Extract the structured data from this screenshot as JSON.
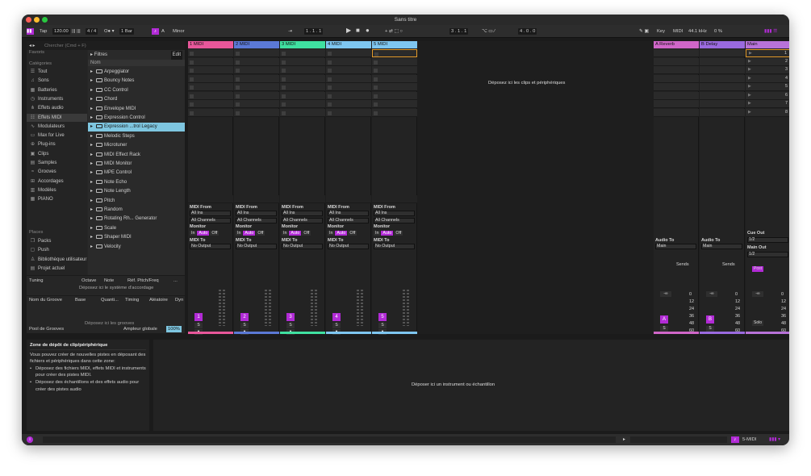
{
  "window": {
    "title": "Sans titre"
  },
  "transport": {
    "tap": "Tap",
    "bpm": "120.00",
    "time_sig": "4 / 4",
    "quant": "1 Bar",
    "key_root": "A",
    "key_scale": "Minor",
    "position": "1 . 1 . 1",
    "loop_start": "3 . 1 . 1",
    "loop_len": "4 . 0 . 0",
    "key_label": "Key",
    "midi_label": "MIDI",
    "sample_rate": "44.1 kHz",
    "cpu": "0 %"
  },
  "browser": {
    "search_placeholder": "Chercher (Cmd + F)",
    "favorites_title": "Favoris",
    "categories_title": "Catégories",
    "places_title": "Places",
    "categories": [
      {
        "label": "Tout",
        "icon": "☰"
      },
      {
        "label": "Sons",
        "icon": "♫"
      },
      {
        "label": "Batteries",
        "icon": "▦"
      },
      {
        "label": "Instruments",
        "icon": "◷"
      },
      {
        "label": "Effets audio",
        "icon": "⋔"
      },
      {
        "label": "Effets MIDI",
        "icon": "☷"
      },
      {
        "label": "Modulateurs",
        "icon": "∿"
      },
      {
        "label": "Max for Live",
        "icon": "▭"
      },
      {
        "label": "Plug-ins",
        "icon": "⊕"
      },
      {
        "label": "Clips",
        "icon": "▣"
      },
      {
        "label": "Samples",
        "icon": "▤"
      },
      {
        "label": "Grooves",
        "icon": "≈"
      },
      {
        "label": "Accordages",
        "icon": "⊞"
      },
      {
        "label": "Modèles",
        "icon": "▥"
      },
      {
        "label": "PIANO",
        "icon": "▦"
      }
    ],
    "places": [
      {
        "label": "Packs",
        "icon": "❐"
      },
      {
        "label": "Push",
        "icon": "▢"
      },
      {
        "label": "Bibliothèque utilisateur",
        "icon": "♙"
      },
      {
        "label": "Projet actuel",
        "icon": "▤"
      }
    ],
    "filters_label": "Filtres",
    "edit_label": "Edit",
    "column_name": "Nom",
    "files": [
      "Arpeggiator",
      "Bouncy Notes",
      "CC Control",
      "Chord",
      "Envelope MIDI",
      "Expression Control",
      "Expression ...trol Legacy",
      "Melodic Steps",
      "Microtuner",
      "MIDI Effect Rack",
      "MIDI Monitor",
      "MPE Control",
      "Note Echo",
      "Note Length",
      "Pitch",
      "Random",
      "Rotating Rh... Generator",
      "Scale",
      "Shaper MIDI",
      "Velocity"
    ]
  },
  "tuning": {
    "title": "Tuning",
    "octave": "Octave",
    "note": "Note",
    "ref": "Réf. Pitch/Freq",
    "more": "...",
    "drop": "Déposez ici le système d'accordage"
  },
  "groove": {
    "cols": [
      "Nom du Groove",
      "Base",
      "Quanti...",
      "Timing",
      "Aléatoire",
      "Dyn"
    ],
    "drop": "Déposez ici les grooves",
    "pool": "Pool de Grooves",
    "amount_label": "Ampleur globale",
    "amount": "100%"
  },
  "help": {
    "title": "Zone de dépôt de clip/périphérique",
    "text": "Vous pouvez créer de nouvelles pistes en déposant des fichiers et périphériques dans cette zone:",
    "b1": "Déposez des fichiers MIDI, effets MIDI et instruments pour créer des pistes MIDI.",
    "b2": "Déposez des échantillons et des effets audio pour créer des pistes audio"
  },
  "session": {
    "drop_text": "Déposez ici les clips et périphériques",
    "device_drop": "Déposer ici un instrument ou échantillon",
    "tracks": [
      {
        "name": "1 MIDI",
        "color": "#e8579a",
        "num": "1"
      },
      {
        "name": "2 MIDI",
        "color": "#5b79d6",
        "num": "2"
      },
      {
        "name": "3 MIDI",
        "color": "#3fe0a0",
        "num": "3"
      },
      {
        "name": "4 MIDI",
        "color": "#7ec6f0",
        "num": "4"
      },
      {
        "name": "5 MIDI",
        "color": "#7ec6f0",
        "num": "5"
      }
    ],
    "io": {
      "from": "MIDI From",
      "all_ins": "All Ins",
      "all_ch": "All Channels",
      "monitor": "Monitor",
      "in": "In",
      "auto": "Auto",
      "off": "Off",
      "to": "MIDI To",
      "no_output": "No Output",
      "solo": "S"
    },
    "returns": [
      {
        "name": "A Reverb",
        "color": "#d066c8",
        "letter": "A"
      },
      {
        "name": "B Delay",
        "color": "#9a6adf",
        "letter": "B"
      }
    ],
    "main": {
      "name": "Main",
      "color": "#b872d9"
    },
    "audio_to": "Audio To",
    "main_out": "Main",
    "sends": "Sends",
    "cue_out": "Cue Out",
    "cue_val": "1/2",
    "main_out_label": "Main Out",
    "main_val": "1/2",
    "post": "Post",
    "inf": "-∞",
    "solo_label": "Solo",
    "scenes": [
      "1",
      "2",
      "3",
      "4",
      "5",
      "6",
      "7",
      "8"
    ],
    "db": [
      "0",
      "12",
      "24",
      "36",
      "48",
      "60"
    ]
  },
  "status": {
    "track": "5-MIDI"
  }
}
